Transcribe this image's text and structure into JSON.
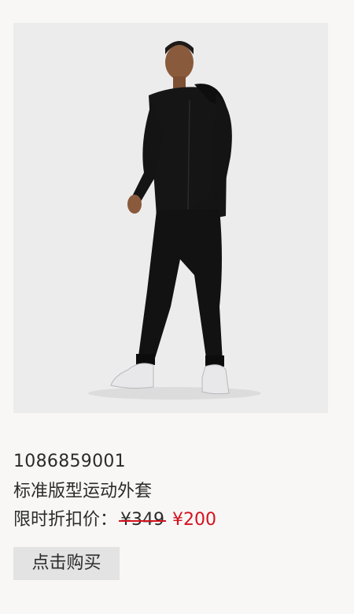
{
  "product": {
    "sku": "1086859001",
    "title": "标准版型运动外套",
    "price_label": "限时折扣价：",
    "original_price": "¥349",
    "sale_price": "¥200",
    "buy_label": "点击购买",
    "image_alt": "model-wearing-black-tracksuit"
  },
  "colors": {
    "background": "#f8f7f6",
    "image_background": "#ececec",
    "sale_price": "#d4121e",
    "strike_line": "#d4121e",
    "button_background": "#e3e3e3",
    "text": "#2b2b2b"
  }
}
